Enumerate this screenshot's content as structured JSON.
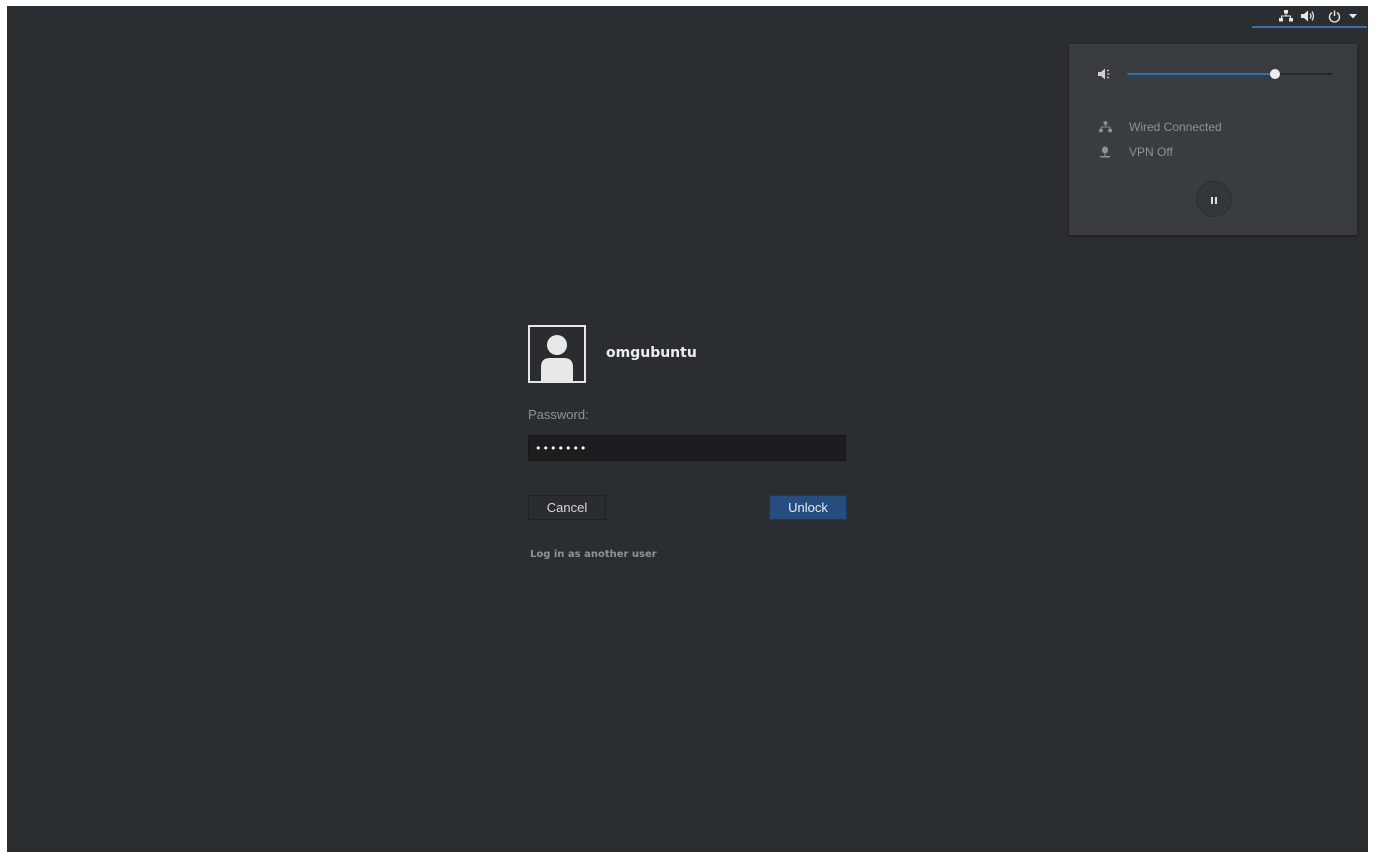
{
  "colors": {
    "background": "#2b2e31",
    "accent": "#2f6cbd",
    "unlock_button": "#274c7e",
    "popover": "#393d40"
  },
  "topbar": {
    "icons": [
      "network-wired-icon",
      "volume-icon",
      "power-icon",
      "dropdown-arrow-icon"
    ]
  },
  "system_menu": {
    "volume": {
      "icon": "volume-icon",
      "level_percent": 72
    },
    "items": [
      {
        "icon": "network-wired-icon",
        "label": "Wired Connected"
      },
      {
        "icon": "vpn-icon",
        "label": "VPN Off"
      }
    ],
    "action_buttons": [
      "suspend-icon"
    ]
  },
  "unlock": {
    "avatar_icon": "user-avatar-icon",
    "username": "omgubuntu",
    "password_label": "Password:",
    "password_value": "•••••••",
    "cancel_label": "Cancel",
    "unlock_label": "Unlock",
    "other_user_label": "Log in as another user"
  }
}
